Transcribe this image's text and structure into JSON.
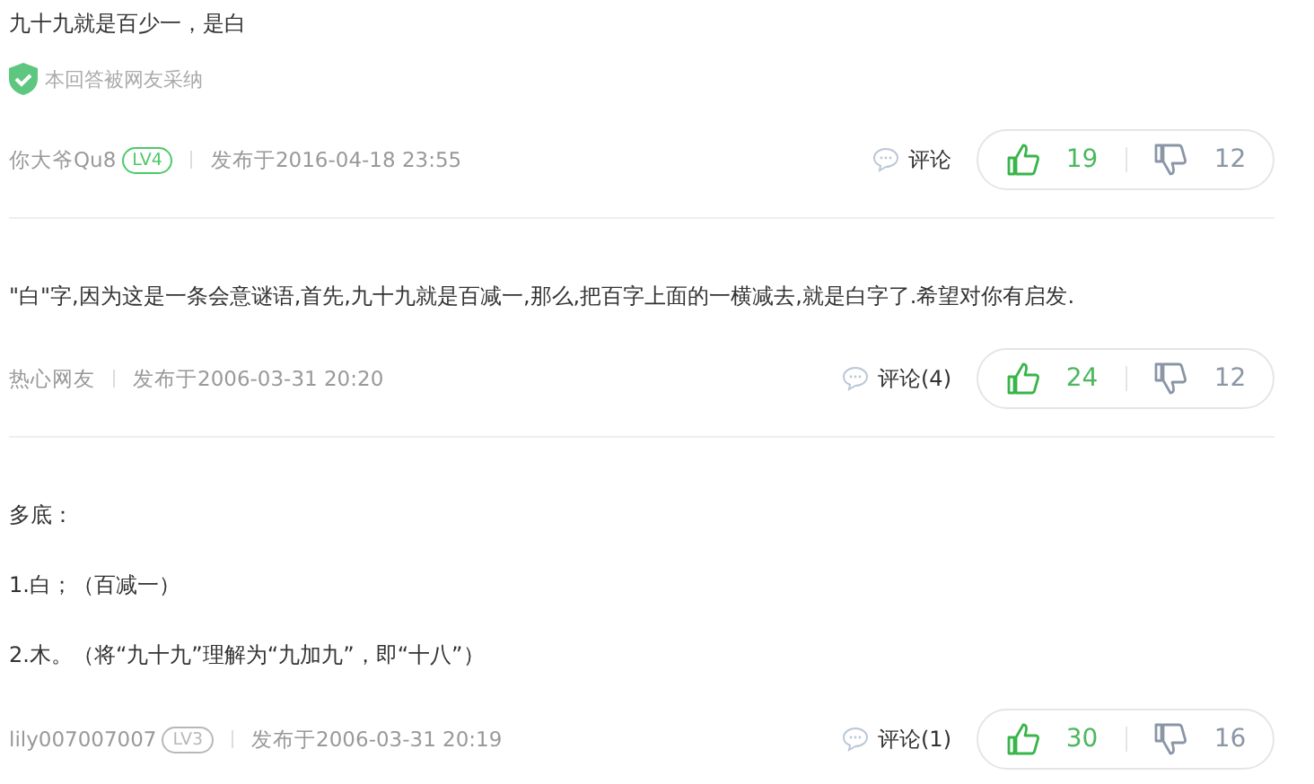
{
  "answers": [
    {
      "paragraphs": [
        "九十九就是百少一，是白"
      ],
      "adopted": true,
      "adopted_label": "本回答被网友采纳",
      "author": "你大爷Qu8",
      "level_badge": {
        "text": "LV4",
        "color": "#4cc96a"
      },
      "posted": "发布于2016-04-18 23:55",
      "comment": "评论",
      "likes": "19",
      "dislikes": "12"
    },
    {
      "paragraphs": [
        "\"白\"字,因为这是一条会意谜语,首先,九十九就是百减一,那么,把百字上面的一横减去,就是白字了.希望对你有启发."
      ],
      "adopted": false,
      "author": "热心网友",
      "posted": "发布于2006-03-31 20:20",
      "comment": "评论(4)",
      "likes": "24",
      "dislikes": "12"
    },
    {
      "paragraphs": [
        "多底：",
        "1.白；（百减一）",
        "2.木。（将“九十九”理解为“九加九”，即“十八”）"
      ],
      "adopted": false,
      "author": "lily007007007",
      "level_badge": {
        "text": "LV3",
        "color": "#b8b8b8"
      },
      "posted": "发布于2006-03-31 20:19",
      "comment": "评论(1)",
      "likes": "30",
      "dislikes": "16"
    }
  ]
}
